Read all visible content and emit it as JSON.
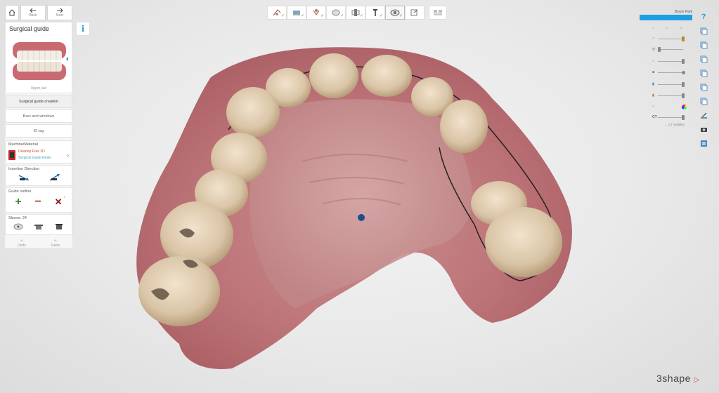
{
  "nav": {
    "back": "Back",
    "next": "Next"
  },
  "panel": {
    "title": "Surgical guide",
    "thumb_caption": "Upper jaw",
    "menu": [
      "Surgical guide creation",
      "Bars and windows",
      "ID tag"
    ],
    "machine": {
      "header": "Machine/Material",
      "line1": "Desktop Free 3D",
      "line2": "Surgical Guide Resin"
    },
    "insertion_header": "Insertion Direction",
    "guide_header": "Guide outline",
    "sleeve_header": "Sleeve: 24",
    "undo": "Undo",
    "redo": "Redo"
  },
  "user": {
    "name": "Byron Park"
  },
  "ticks": [
    "1",
    "2",
    "3"
  ],
  "right_labels": {
    "ct": "CT",
    "collapse": "CT visibility"
  },
  "brand": "3shape",
  "colors": {
    "accent": "#1e9ee4",
    "check": "#3aa33a",
    "add": "#2e8b2e",
    "remove": "#c0392b"
  },
  "icons": {
    "top_steps": [
      "scan-icon",
      "align-icon",
      "implant-icon",
      "crown-icon",
      "sleeve-icon",
      "drill-icon",
      "guide-icon",
      "export-icon"
    ],
    "right_tools": [
      "help-icon",
      "layer-icon",
      "layer-icon",
      "layer-icon",
      "layer-icon",
      "layer-icon",
      "layer-icon",
      "measure-icon",
      "camera-icon",
      "view-icon"
    ]
  }
}
